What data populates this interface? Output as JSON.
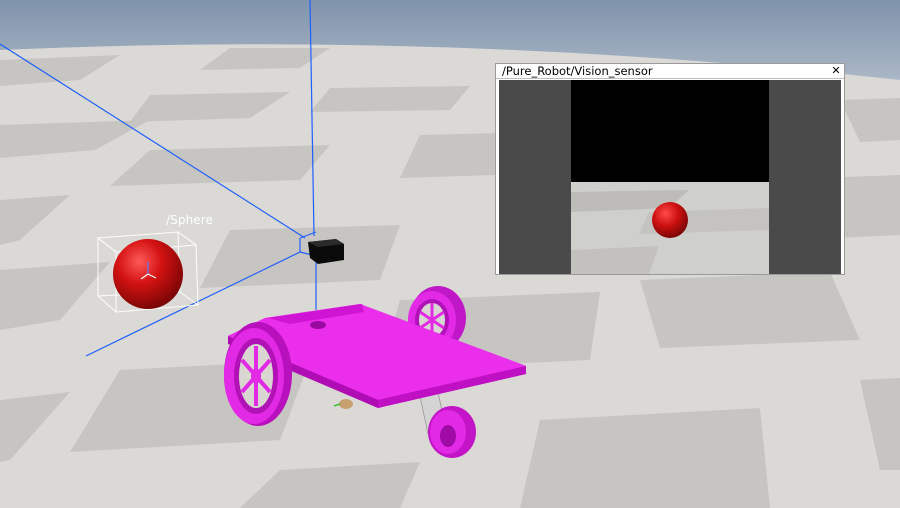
{
  "scene": {
    "object_label": "/Sphere"
  },
  "vision_window": {
    "title": "/Pure_Robot/Vision_sensor",
    "close_icon": "close-icon"
  },
  "colors": {
    "floor_light": "#dcdbd7",
    "floor_dark": "#c4c3bf",
    "sky": "#8fa0b5",
    "robot": "#e81ce8",
    "sphere": "#d01010",
    "frustum": "#1f5fff"
  }
}
